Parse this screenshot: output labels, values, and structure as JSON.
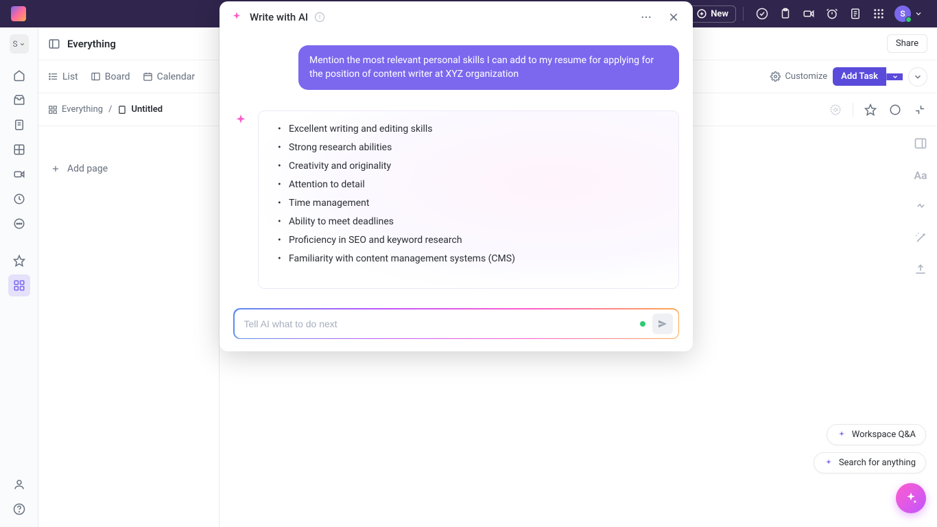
{
  "topbar": {
    "new_label": "New",
    "avatar_initial": "S"
  },
  "panel": {
    "title": "Everything",
    "tabs": [
      "List",
      "Board",
      "Calendar"
    ],
    "crumbs": {
      "root": "Everything",
      "current": "Untitled"
    },
    "add_page": "Add page",
    "workspace_initial": "S"
  },
  "main": {
    "share": "Share",
    "customize": "Customize",
    "add_task": "Add Task"
  },
  "modal": {
    "title": "Write with AI",
    "user_message": "Mention the most relevant personal skills I can add to my resume for applying for the position of content writer at XYZ organization",
    "ai_skills": [
      "Excellent writing and editing skills",
      "Strong research abilities",
      "Creativity and originality",
      "Attention to detail",
      "Time management",
      "Ability to meet deadlines",
      "Proficiency in SEO and keyword research",
      "Familiarity with content management systems (CMS)"
    ],
    "input_placeholder": "Tell AI what to do next"
  },
  "pills": {
    "qa": "Workspace Q&A",
    "search": "Search for anything"
  }
}
